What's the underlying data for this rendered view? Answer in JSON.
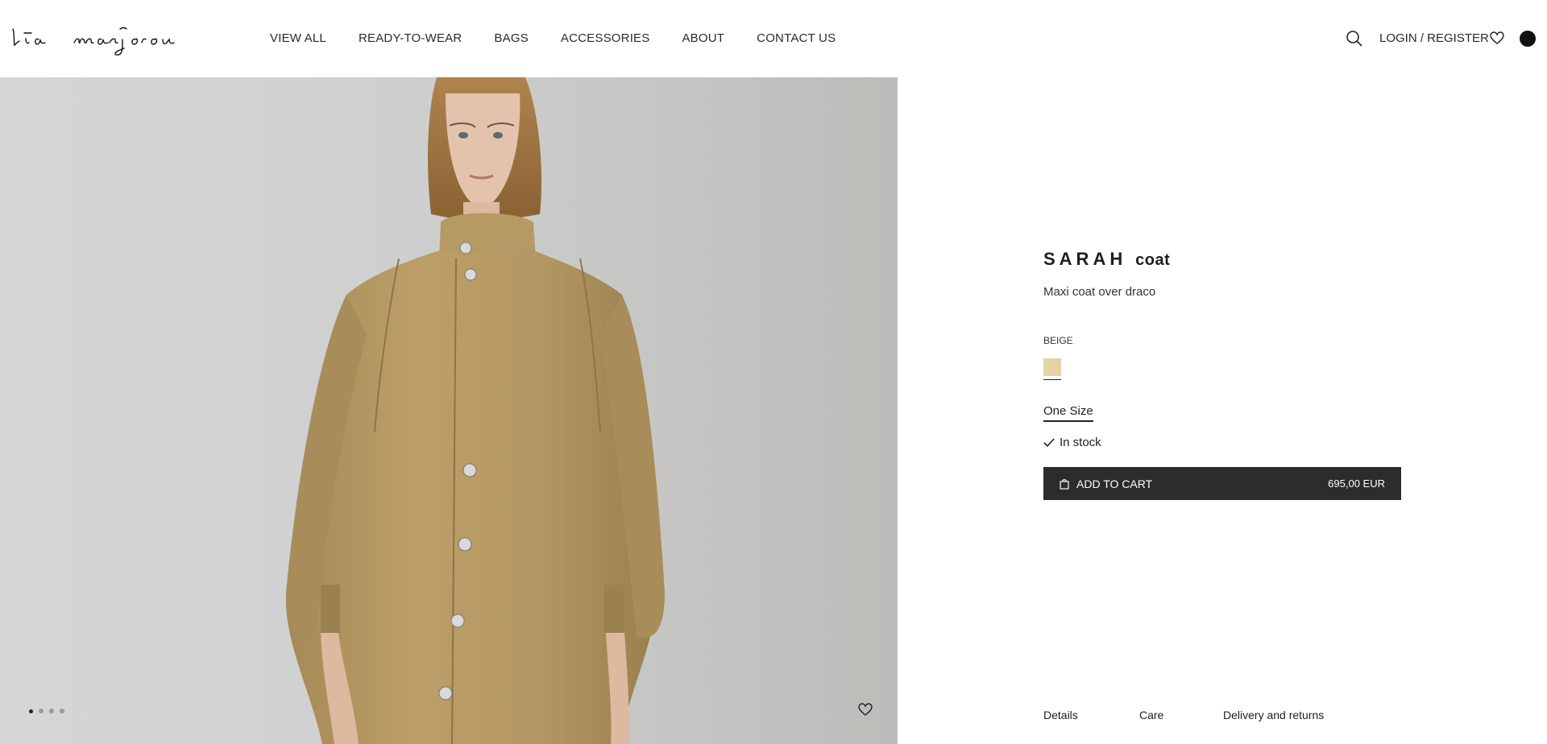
{
  "header": {
    "brand": "lia manjorou",
    "nav": [
      "VIEW ALL",
      "READY-TO-WEAR",
      "BAGS",
      "ACCESSORIES",
      "ABOUT",
      "CONTACT US"
    ],
    "login_label": "LOGIN / REGISTER"
  },
  "gallery": {
    "slide_count": 4,
    "active_slide": 1
  },
  "product": {
    "name": "SARAH",
    "type": "coat",
    "description": "Maxi coat over draco",
    "color_label": "BEIGE",
    "swatch_color": "#e4d3a5",
    "size": "One Size",
    "stock": "In stock",
    "add_to_cart_label": "ADD TO CART",
    "price": "695,00 EUR"
  },
  "tabs": [
    "Details",
    "Care",
    "Delivery and returns"
  ],
  "colors": {
    "button_bg": "#2c2c2c",
    "text": "#1e1e1e"
  }
}
